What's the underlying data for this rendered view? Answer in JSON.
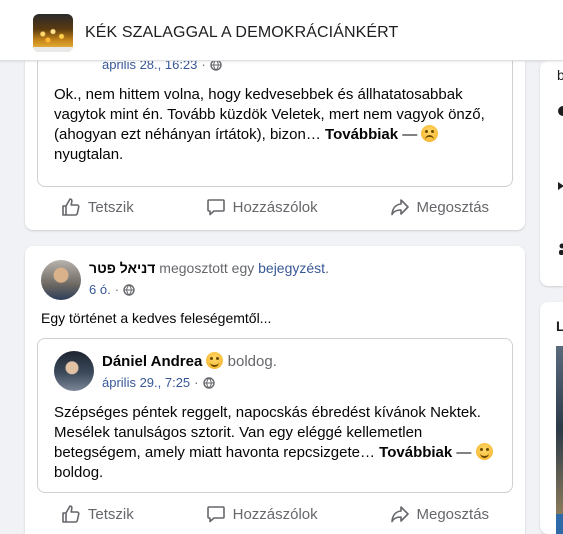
{
  "header": {
    "group_name": "KÉK SZALAGGAL A DEMOKRÁCIÁNKÉRT"
  },
  "post1": {
    "shared": {
      "timestamp": "április 28., 16:23",
      "separator": "·",
      "text": "Ok., nem hittem volna, hogy kedvesebbek és állhatatosabbak vagytok mint én. Tovább küzdök Veletek, mert nem vagyok önző, (ahogyan ezt néhányan írtátok), bizon…",
      "see_more": "Továbbiak",
      "dash": "—",
      "feeling": "nyugtalan."
    }
  },
  "post2": {
    "author": "דניאל פטר",
    "action": "megosztott egy",
    "link": "bejegyzést",
    "period": ".",
    "timestamp": "6 ó.",
    "separator": "·",
    "caption": "Egy történet a kedves feleségemtől...",
    "shared": {
      "author": "Dániel Andrea",
      "feeling": "boldog.",
      "timestamp": "április 29., 7:25",
      "separator": "·",
      "text": "Szépséges péntek reggelt, napocskás ébredést kívánok Nektek. Mesélek tanulságos sztorit. Van egy eléggé kellemetlen betegségem, amely miatt havonta repcsizgete…",
      "see_more": "Továbbiak",
      "dash": "—",
      "feeling_end": "boldog."
    }
  },
  "actions": {
    "like": "Tetszik",
    "comment": "Hozzászólok",
    "share": "Megosztás"
  },
  "right_sidebar": {
    "glyphs": [
      "b",
      "L"
    ]
  },
  "icons": {
    "like": "thumbs-up-icon",
    "comment": "speech-bubble-icon",
    "share": "share-arrow-icon",
    "privacy": "globe-icon"
  },
  "colors": {
    "link": "#385898",
    "secondary_text": "#65676b",
    "background": "#f0f2f5"
  }
}
